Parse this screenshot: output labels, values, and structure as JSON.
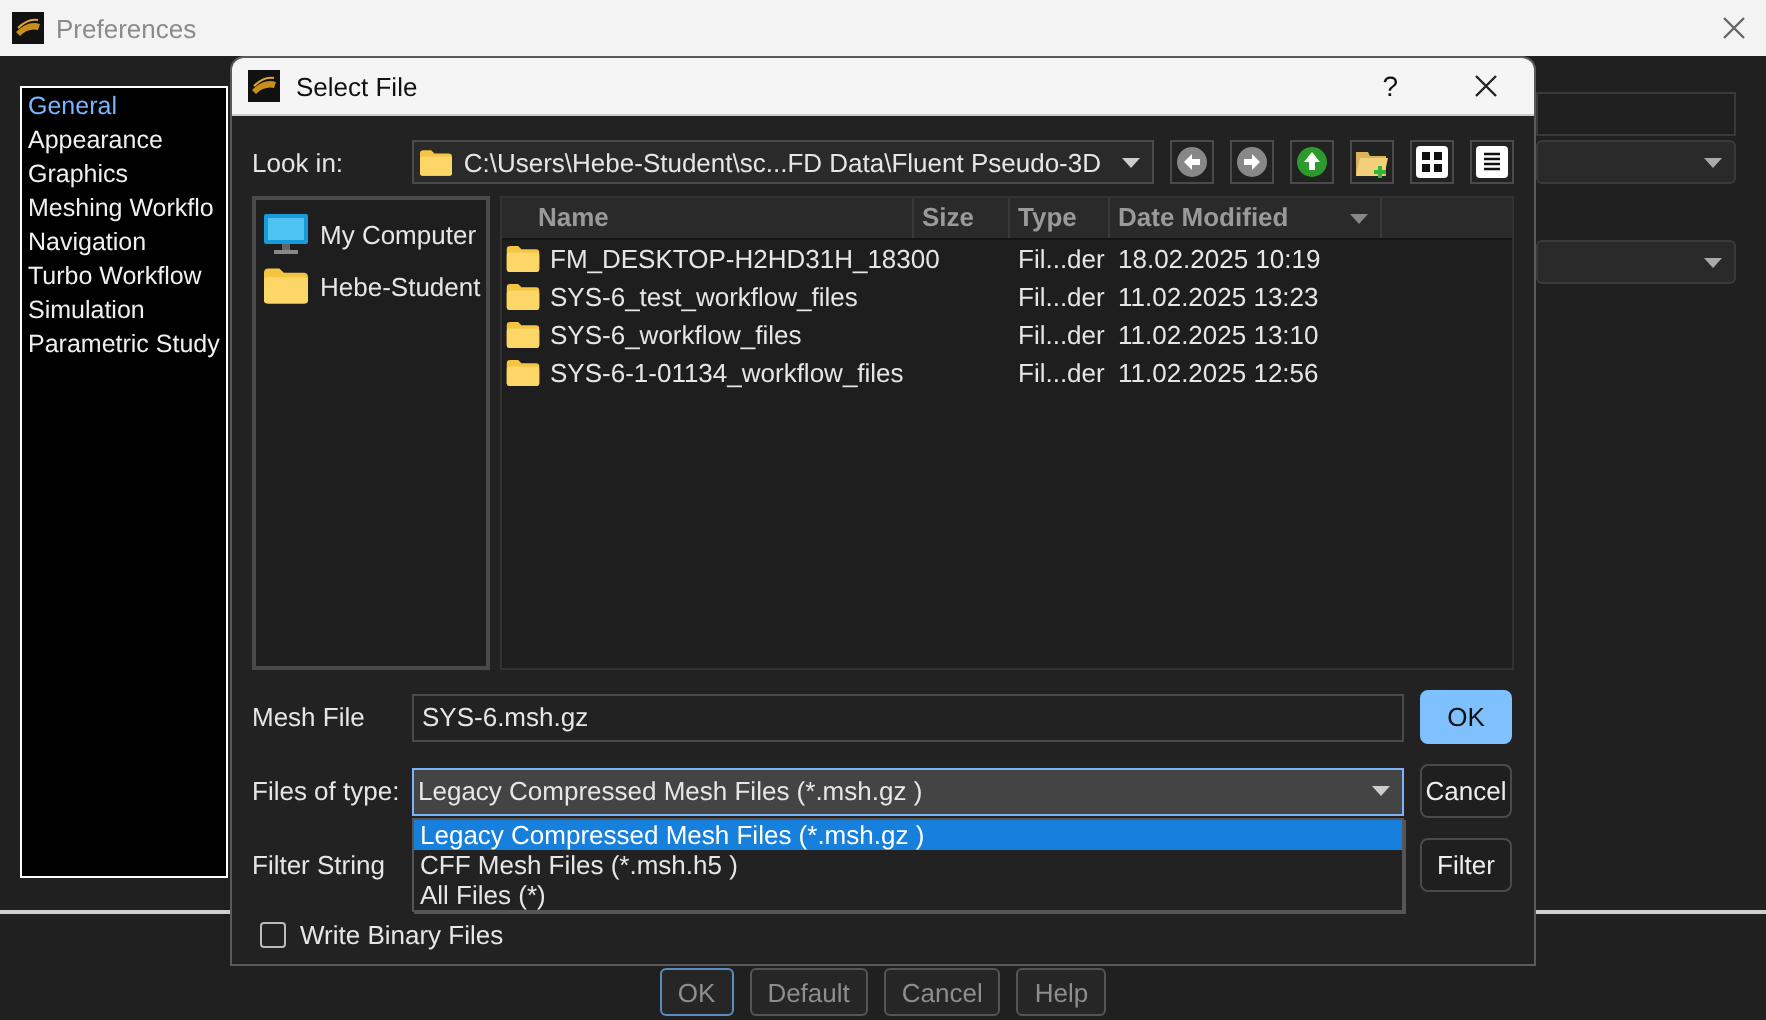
{
  "preferences": {
    "title": "Preferences",
    "sidebar": [
      {
        "label": "General",
        "selected": true
      },
      {
        "label": "Appearance",
        "selected": false
      },
      {
        "label": "Graphics",
        "selected": false
      },
      {
        "label": "Meshing Workflo",
        "selected": false
      },
      {
        "label": "Navigation",
        "selected": false
      },
      {
        "label": "Turbo Workflow",
        "selected": false
      },
      {
        "label": "Simulation",
        "selected": false
      },
      {
        "label": "Parametric Study",
        "selected": false
      }
    ],
    "buttons": [
      {
        "label": "OK",
        "default": true
      },
      {
        "label": "Default",
        "default": false
      },
      {
        "label": "Cancel",
        "default": false
      },
      {
        "label": "Help",
        "default": false
      }
    ]
  },
  "dialog": {
    "title": "Select File",
    "help": "?",
    "look_in": {
      "label": "Look in:",
      "path": "C:\\Users\\Hebe-Student\\sc...FD Data\\Fluent Pseudo-3D"
    },
    "places": [
      {
        "label": "My Computer",
        "kind": "computer"
      },
      {
        "label": "Hebe-Student",
        "kind": "folder"
      }
    ],
    "columns": [
      "Name",
      "Size",
      "Type",
      "Date Modified"
    ],
    "rows": [
      {
        "name": "FM_DESKTOP-H2HD31H_18300",
        "type": "Fil...der",
        "date": "18.02.2025 10:19"
      },
      {
        "name": "SYS-6_test_workflow_files",
        "type": "Fil...der",
        "date": "11.02.2025 13:23"
      },
      {
        "name": "SYS-6_workflow_files",
        "type": "Fil...der",
        "date": "11.02.2025 13:10"
      },
      {
        "name": "SYS-6-1-01134_workflow_files",
        "type": "Fil...der",
        "date": "11.02.2025 12:56"
      }
    ],
    "mesh_file": {
      "label": "Mesh File",
      "value": "SYS-6.msh.gz"
    },
    "files_of_type": {
      "label": "Files of type:",
      "value": "Legacy Compressed Mesh Files (*.msh.gz )",
      "options": [
        {
          "label": "Legacy Compressed Mesh Files (*.msh.gz )",
          "selected": true
        },
        {
          "label": "CFF Mesh Files (*.msh.h5 )",
          "selected": false
        },
        {
          "label": "All Files (*)",
          "selected": false
        }
      ]
    },
    "filter_string": {
      "label": "Filter String"
    },
    "write_binary": {
      "label": "Write Binary Files",
      "checked": false
    },
    "buttons": [
      {
        "label": "OK",
        "kind": "primary"
      },
      {
        "label": "Cancel",
        "kind": "normal"
      },
      {
        "label": "Filter",
        "kind": "normal"
      }
    ]
  }
}
